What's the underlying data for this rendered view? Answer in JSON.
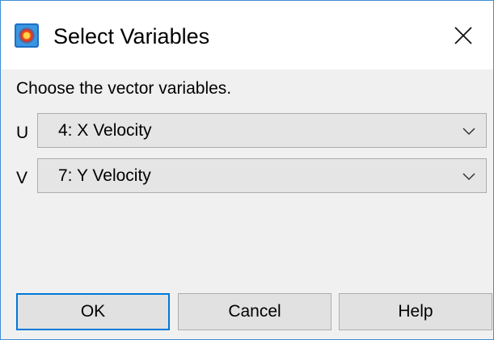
{
  "window": {
    "title": "Select Variables",
    "icon": "tecplot-app-icon",
    "close_icon": "close-icon"
  },
  "dialog": {
    "prompt": "Choose the vector variables.",
    "fields": [
      {
        "label": "U",
        "selected": "4: X Velocity"
      },
      {
        "label": "V",
        "selected": "7: Y Velocity"
      }
    ]
  },
  "buttons": {
    "ok": "OK",
    "cancel": "Cancel",
    "help": "Help"
  },
  "colors": {
    "accent": "#0078d7",
    "window_border": "#3f8fd8",
    "dialog_bg": "#f0f0f0",
    "combo_bg": "#e5e5e5",
    "button_bg": "#e1e1e1"
  }
}
